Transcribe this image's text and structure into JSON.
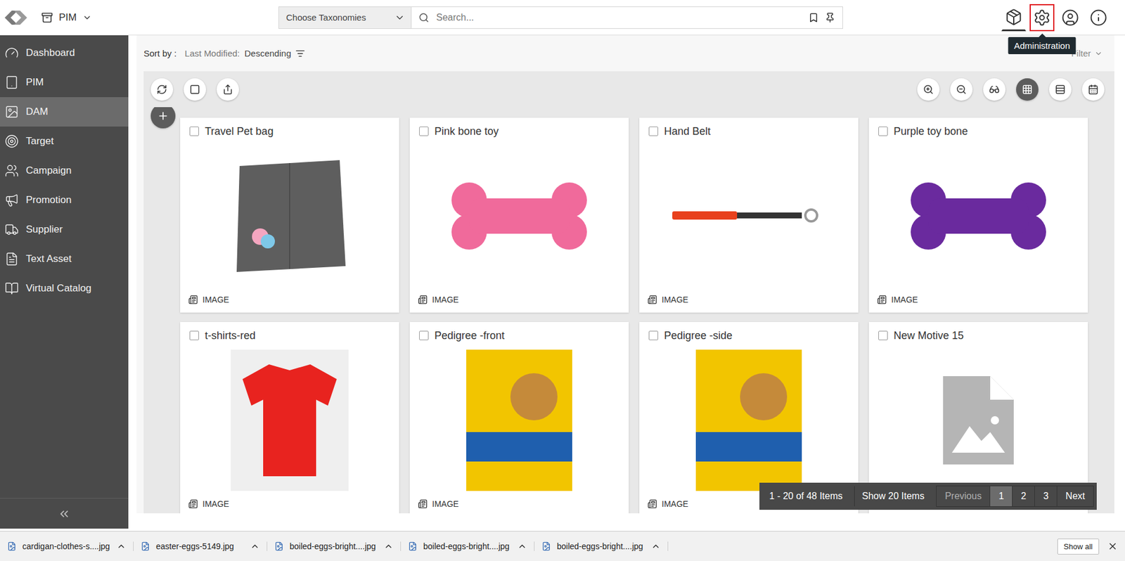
{
  "header": {
    "module": "PIM",
    "taxonomy_placeholder": "Choose Taxonomies",
    "search_placeholder": "Search...",
    "icons": [
      {
        "kind": "box",
        "selected": true,
        "highlighted": false
      },
      {
        "kind": "settings",
        "selected": false,
        "highlighted": true
      },
      {
        "kind": "user",
        "selected": false,
        "highlighted": false
      },
      {
        "kind": "info",
        "selected": false,
        "highlighted": false
      }
    ],
    "tooltip": "Administration"
  },
  "sidebar": {
    "items": [
      {
        "label": "Dashboard",
        "selected": false
      },
      {
        "label": "PIM",
        "selected": false
      },
      {
        "label": "DAM",
        "selected": true
      },
      {
        "label": "Target",
        "selected": false
      },
      {
        "label": "Campaign",
        "selected": false
      },
      {
        "label": "Promotion",
        "selected": false
      },
      {
        "label": "Supplier",
        "selected": false
      },
      {
        "label": "Text Asset",
        "selected": false
      },
      {
        "label": "Virtual Catalog",
        "selected": false
      }
    ]
  },
  "sort": {
    "label": "Sort by :",
    "field": "Last Modified:",
    "order": "Descending"
  },
  "filter": {
    "label": "Filter"
  },
  "tools_left": [
    {
      "kind": "refresh"
    },
    {
      "kind": "select"
    },
    {
      "kind": "export"
    }
  ],
  "tools_right": [
    {
      "kind": "zoom-in",
      "selected": false
    },
    {
      "kind": "zoom-out",
      "selected": false
    },
    {
      "kind": "preview",
      "selected": false
    },
    {
      "kind": "grid",
      "selected": true
    },
    {
      "kind": "list",
      "selected": false
    },
    {
      "kind": "calendar",
      "selected": false
    }
  ],
  "cards": [
    {
      "title": "Travel Pet bag",
      "type": "IMAGE",
      "checked": false,
      "kind": "bag",
      "color": "#5e5e5e"
    },
    {
      "title": "Pink bone toy",
      "type": "IMAGE",
      "checked": false,
      "kind": "bone",
      "color": "#f06a9b"
    },
    {
      "title": "Hand Belt",
      "type": "IMAGE",
      "checked": false,
      "kind": "belt",
      "color": "#e8401c"
    },
    {
      "title": "Purple toy bone",
      "type": "IMAGE",
      "checked": false,
      "kind": "bone",
      "color": "#6a2a9e"
    },
    {
      "title": "t-shirts-red",
      "type": "IMAGE",
      "checked": false,
      "kind": "shirt",
      "color": "#e8231f"
    },
    {
      "title": "Pedigree -front",
      "type": "IMAGE",
      "checked": false,
      "kind": "food",
      "color": "#f2c500"
    },
    {
      "title": "Pedigree -side",
      "type": "IMAGE",
      "checked": false,
      "kind": "food",
      "color": "#f2c500"
    },
    {
      "title": "New Motive 15",
      "type": "IMAGE",
      "checked": false,
      "kind": "placeholder",
      "color": "#b5b5b5"
    }
  ],
  "pagination": {
    "range": "1 - 20 of 48 Items",
    "page_size": "Show 20 Items",
    "previous": "Previous",
    "next": "Next",
    "previous_disabled": true,
    "pages": [
      {
        "label": "1",
        "selected": true
      },
      {
        "label": "2",
        "selected": false
      },
      {
        "label": "3",
        "selected": false
      }
    ]
  },
  "downloads": {
    "items": [
      "cardigan-clothes-s....jpg",
      "easter-eggs-5149.jpg",
      "boiled-eggs-bright....jpg",
      "boiled-eggs-bright....jpg",
      "boiled-eggs-bright....jpg"
    ],
    "show_all": "Show all"
  }
}
